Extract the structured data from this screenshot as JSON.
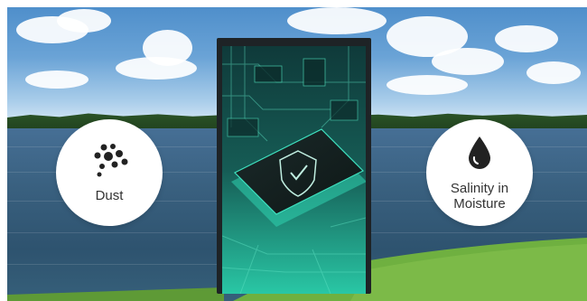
{
  "features": [
    {
      "label": "Dust",
      "icon": "dust-particles-icon"
    },
    {
      "label": "Salinity in Moisture",
      "icon": "water-drop-icon"
    }
  ],
  "screen_content": {
    "icon": "shield-check-icon"
  },
  "colors": {
    "badge_background": "#ffffff",
    "display_frame": "#1e2326",
    "circuit_teal": "#2fd3b0",
    "grass": "#6fb040"
  }
}
